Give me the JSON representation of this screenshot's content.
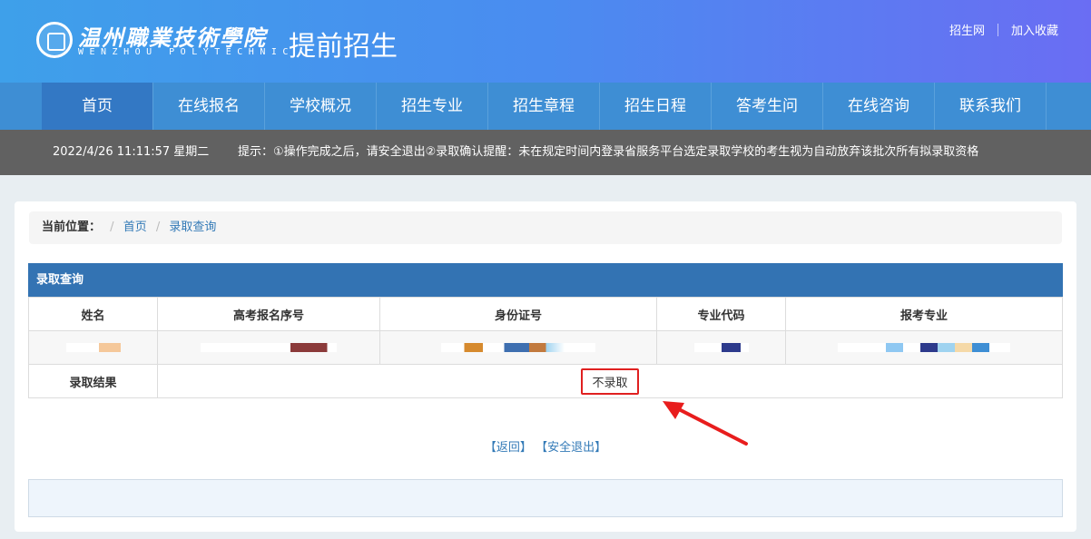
{
  "header": {
    "logo_cn": "温州職業技術學院",
    "logo_en": "WENZHOU POLYTECHNIC",
    "title": "提前招生",
    "links": [
      "招生网",
      "加入收藏"
    ]
  },
  "nav": {
    "items": [
      "首页",
      "在线报名",
      "学校概况",
      "招生专业",
      "招生章程",
      "招生日程",
      "答考生问",
      "在线咨询",
      "联系我们"
    ],
    "active_index": 0
  },
  "notice": {
    "datetime": "2022/4/26 11:11:57 星期二",
    "tip": "提示：①操作完成之后，请安全退出②录取确认提醒：未在规定时间内登录省服务平台选定录取学校的考生视为自动放弃该批次所有拟录取资格"
  },
  "breadcrumb": {
    "label": "当前位置：",
    "items": [
      "首页",
      "录取查询"
    ]
  },
  "query": {
    "title": "录取查询",
    "columns": [
      "姓名",
      "高考报名序号",
      "身份证号",
      "专业代码",
      "报考专业"
    ],
    "result_label": "录取结果",
    "result_value": "不录取"
  },
  "actions": {
    "back": "【返回】",
    "logout": "【安全退出】"
  },
  "colors": {
    "header_start": "#3ea0ea",
    "header_end": "#6a6df3",
    "nav": "#3e8ed4",
    "table_head": "#3373b3",
    "highlight": "#e02020"
  }
}
